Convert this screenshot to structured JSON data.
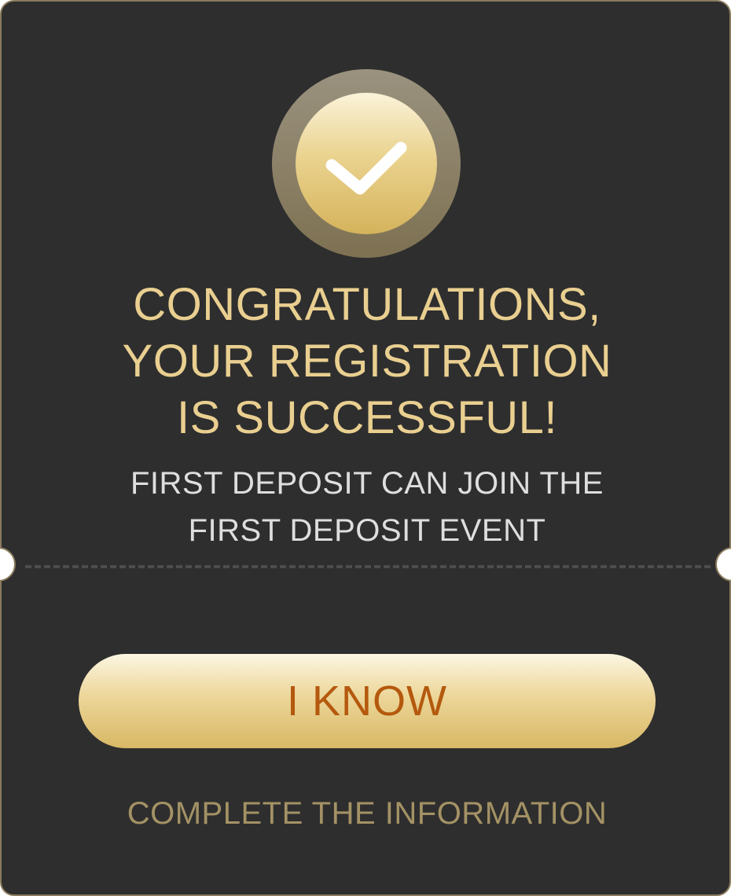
{
  "dialog": {
    "headline_lines": [
      "CONGRATULATIONS,",
      "YOUR REGISTRATION",
      "IS SUCCESSFUL!"
    ],
    "subtext_lines": [
      "FIRST DEPOSIT CAN JOIN THE",
      "FIRST DEPOSIT EVENT"
    ],
    "primary_button_label": "I KNOW",
    "secondary_link_label": "COMPLETE THE INFORMATION",
    "icon": "checkmark-icon"
  },
  "colors": {
    "card_background": "#2e2e2e",
    "card_border": "#8a7a5c",
    "gold_text": "#e9cf90",
    "body_text": "#dedede",
    "button_text": "#b4590e",
    "link_text": "#a49265"
  }
}
